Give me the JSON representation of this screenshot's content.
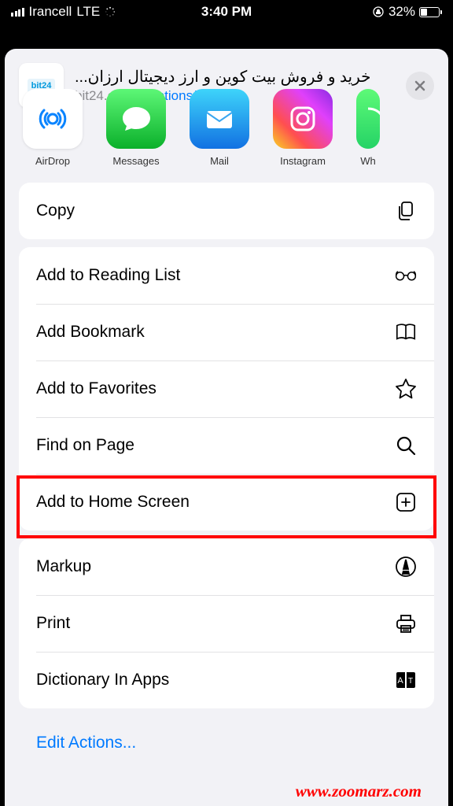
{
  "statusbar": {
    "carrier": "Irancell",
    "network": "LTE",
    "time": "3:40 PM",
    "battery_pct": "32%"
  },
  "header": {
    "site_icon_label": "bit24",
    "title": "خرید و فروش بیت کوین و ارز دیجیتال ارزان...",
    "url": "bit24.cash",
    "options": "Options"
  },
  "apps": [
    {
      "label": "AirDrop"
    },
    {
      "label": "Messages"
    },
    {
      "label": "Mail"
    },
    {
      "label": "Instagram"
    },
    {
      "label": "Wh"
    }
  ],
  "group1": [
    {
      "label": "Copy"
    }
  ],
  "group2": [
    {
      "label": "Add to Reading List"
    },
    {
      "label": "Add Bookmark"
    },
    {
      "label": "Add to Favorites"
    },
    {
      "label": "Find on Page"
    },
    {
      "label": "Add to Home Screen"
    }
  ],
  "group3": [
    {
      "label": "Markup"
    },
    {
      "label": "Print"
    },
    {
      "label": "Dictionary In Apps"
    }
  ],
  "edit_actions": "Edit Actions...",
  "watermark": "www.zoomarz.com"
}
